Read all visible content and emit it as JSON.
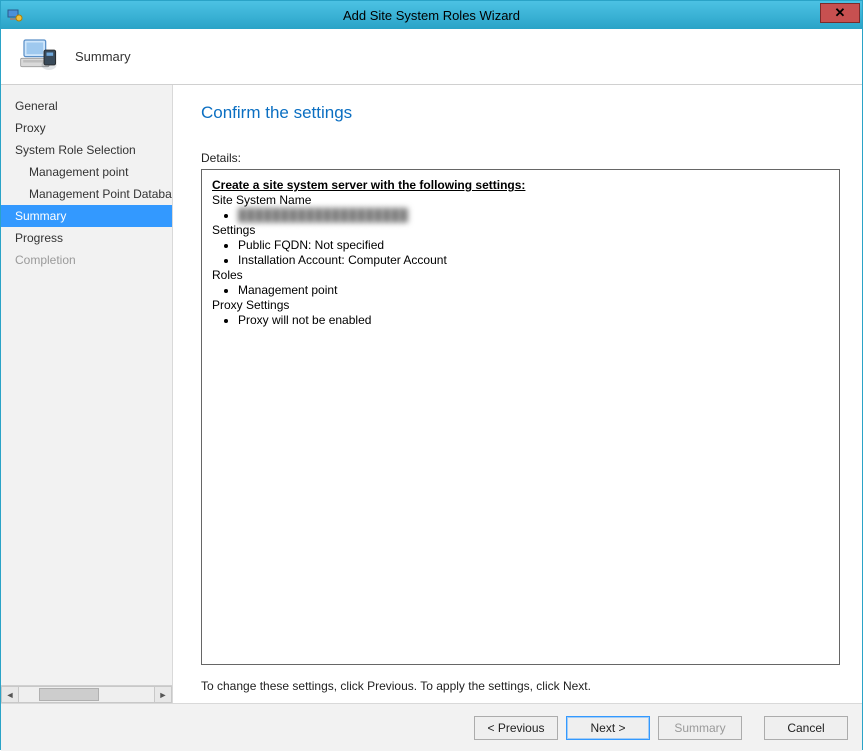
{
  "window": {
    "title": "Add Site System Roles Wizard"
  },
  "header": {
    "step_title": "Summary"
  },
  "sidebar": {
    "items": [
      {
        "label": "General"
      },
      {
        "label": "Proxy"
      },
      {
        "label": "System Role Selection"
      },
      {
        "label": "Management point"
      },
      {
        "label": "Management Point Database"
      },
      {
        "label": "Summary"
      },
      {
        "label": "Progress"
      },
      {
        "label": "Completion"
      }
    ]
  },
  "main": {
    "heading": "Confirm the settings",
    "details_label": "Details:",
    "details": {
      "headline": "Create a site system server with the following settings:",
      "site_system_label": "Site System Name",
      "site_system_value": "████████████████████",
      "settings_label": "Settings",
      "settings_items": [
        "Public FQDN: Not specified",
        "Installation Account: Computer Account"
      ],
      "roles_label": "Roles",
      "roles_items": [
        "Management point"
      ],
      "proxy_label": "Proxy Settings",
      "proxy_items": [
        "Proxy will not be enabled"
      ]
    },
    "hint": "To change these settings, click Previous. To apply the settings, click Next."
  },
  "footer": {
    "previous": "< Previous",
    "next": "Next >",
    "summary": "Summary",
    "cancel": "Cancel"
  }
}
